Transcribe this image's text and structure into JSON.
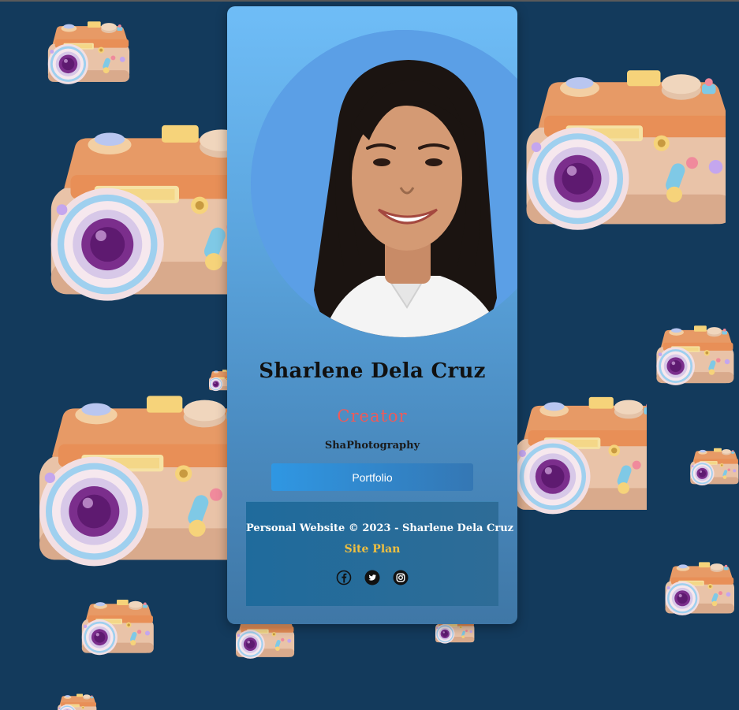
{
  "profile": {
    "name": "Sharlene Dela Cruz",
    "role": "Creator",
    "brand": "ShaPhotography",
    "portfolio_label": "Portfolio"
  },
  "footer": {
    "copyright": "Personal Website © 2023 - Sharlene Dela Cruz",
    "site_plan_label": "Site Plan",
    "social": [
      {
        "icon": "facebook-icon"
      },
      {
        "icon": "twitter-icon"
      },
      {
        "icon": "instagram-icon"
      }
    ]
  },
  "colors": {
    "page_background": "#133a5c",
    "card_top": "#6fbdf7",
    "card_bottom": "#3f77a6",
    "role_accent": "#ee5a5a",
    "link_accent": "#f0c040",
    "button": "#2f97e3"
  }
}
